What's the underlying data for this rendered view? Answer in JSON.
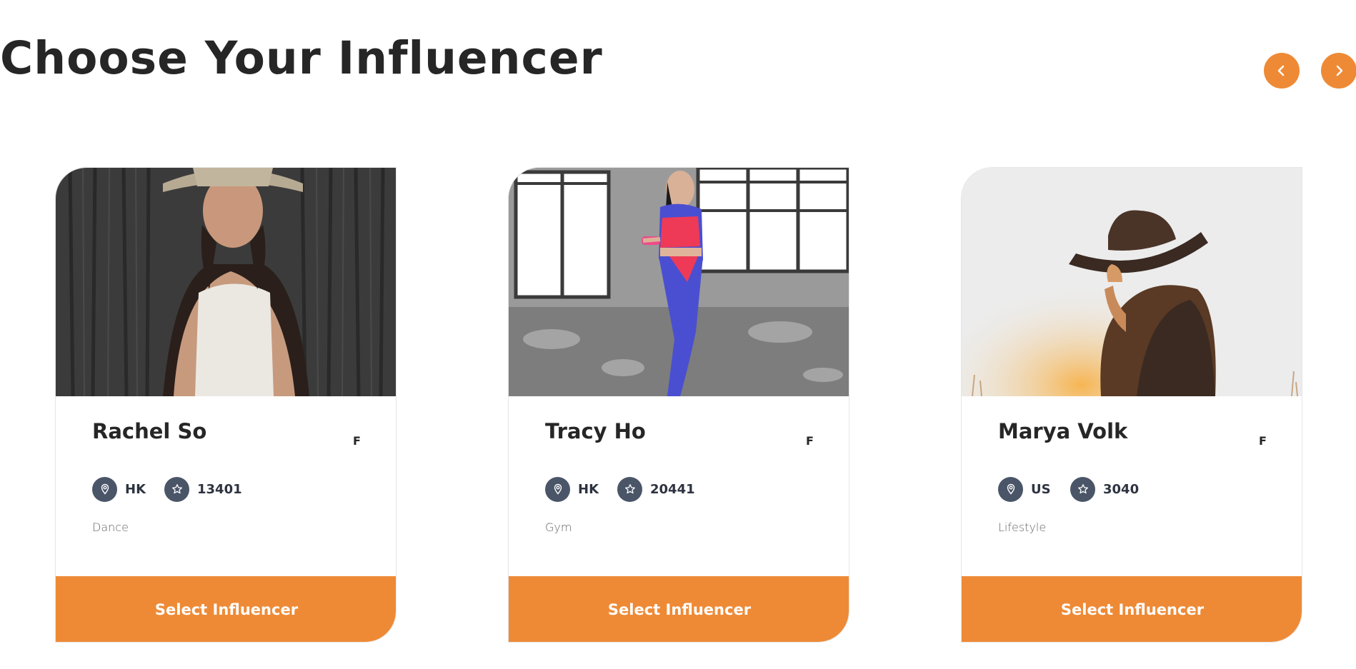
{
  "page": {
    "title": "Choose Your Influencer"
  },
  "carousel": {
    "prev_icon": "chevron-left-icon",
    "next_icon": "chevron-right-icon"
  },
  "theme": {
    "accent": "#ee8a36",
    "meta_icon_bg": "#4a5568",
    "title_color": "#262626"
  },
  "cards": [
    {
      "name": "Rachel So",
      "gender": "F",
      "location": "HK",
      "followers": "13401",
      "category": "Dance",
      "button_label": "Select Influencer",
      "photo": "woman-with-hat-dark-wall-photo"
    },
    {
      "name": "Tracy Ho",
      "gender": "F",
      "location": "HK",
      "followers": "20441",
      "category": "Gym",
      "button_label": "Select Influencer",
      "photo": "woman-fitness-dumbbell-photo"
    },
    {
      "name": "Marya Volk",
      "gender": "F",
      "location": "US",
      "followers": "3040",
      "category": "Lifestyle",
      "button_label": "Select Influencer",
      "photo": "woman-fedora-sunset-photo"
    }
  ]
}
